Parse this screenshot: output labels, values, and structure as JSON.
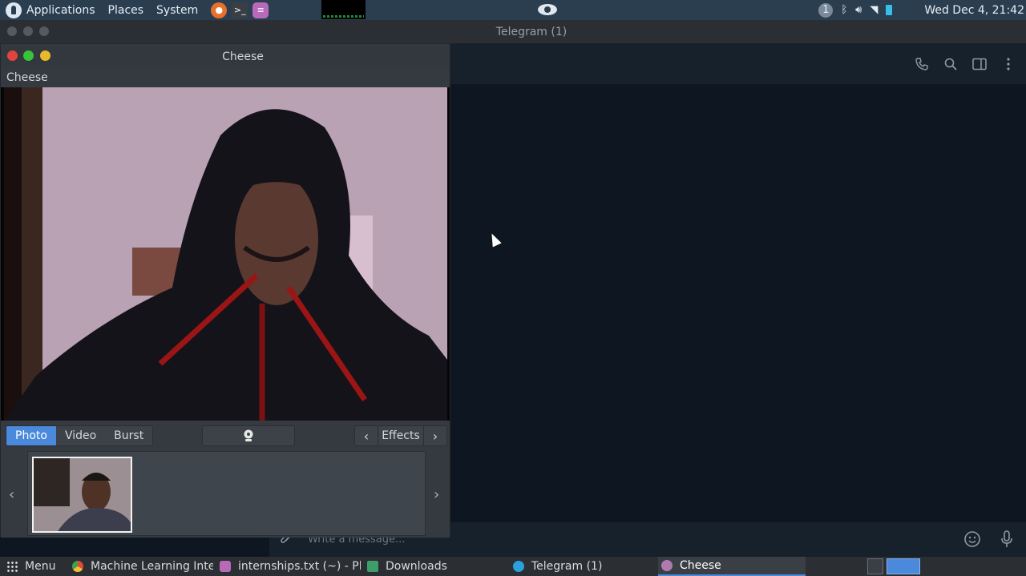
{
  "top_panel": {
    "menus": [
      "Applications",
      "Places",
      "System"
    ],
    "launchers": [
      {
        "icon": "firefox-icon",
        "color": "#e8702a"
      },
      {
        "icon": "terminal-icon",
        "color": "#3a3f45"
      },
      {
        "icon": "text-editor-icon",
        "color": "#b86ab8"
      }
    ],
    "tray_icons": [
      "notification-icon",
      "bluetooth-icon",
      "volume-icon",
      "wifi-icon",
      "battery-icon"
    ],
    "notification_count": "1",
    "clock": "Wed Dec  4, 21:42"
  },
  "telegram": {
    "window_title": "Telegram (1)",
    "header_icons": [
      "phone-icon",
      "search-icon",
      "sidebar-icon",
      "more-icon"
    ],
    "composer_placeholder": "Write a message..."
  },
  "cheese": {
    "window_title": "Cheese",
    "menu_label": "Cheese",
    "modes": [
      {
        "label": "Photo",
        "active": true
      },
      {
        "label": "Video",
        "active": false
      },
      {
        "label": "Burst",
        "active": false
      }
    ],
    "effects_label": "Effects",
    "thumbnail_count": 1
  },
  "taskbar": {
    "menu_label": "Menu",
    "items": [
      {
        "label": "Machine Learning Inter...",
        "icon": "chrome-icon",
        "color": "#3fa14a",
        "active": false
      },
      {
        "label": "internships.txt (~) - Plu...",
        "icon": "text-editor-icon",
        "color": "#b86ab8",
        "active": false
      },
      {
        "label": "Downloads",
        "icon": "folder-icon",
        "color": "#3f9d6a",
        "active": false
      },
      {
        "label": "Telegram (1)",
        "icon": "telegram-icon",
        "color": "#2aa1da",
        "active": false
      },
      {
        "label": "Cheese",
        "icon": "cheese-icon",
        "color": "#b07ab0",
        "active": true
      }
    ]
  },
  "colors": {
    "accent": "#4a89dc",
    "panel": "#2b3e50",
    "chat_bg": "#0e1621",
    "close": "#e0443e",
    "minimize": "#37c43a",
    "maximize": "#e8b92a"
  }
}
